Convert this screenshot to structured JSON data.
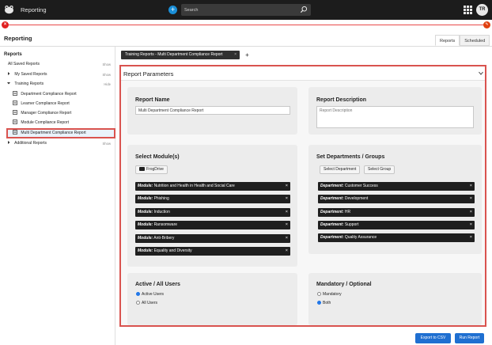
{
  "header": {
    "app_title": "Reporting",
    "search_placeholder": "Search",
    "avatar_initials": "TR"
  },
  "page": {
    "title": "Reporting",
    "tabs": [
      "Reports",
      "Scheduled"
    ]
  },
  "sidebar": {
    "heading": "Reports",
    "items": [
      {
        "label": "All Saved Reports",
        "toggle": "Show"
      },
      {
        "label": "My Saved Reports",
        "toggle": "Show"
      },
      {
        "label": "Training Reports",
        "toggle": "Hide"
      },
      {
        "label": "Department Compliance Report"
      },
      {
        "label": "Learner Compliance Report"
      },
      {
        "label": "Manager Compliance Report"
      },
      {
        "label": "Module Compliance Report"
      },
      {
        "label": "Multi Department Compliance Report"
      },
      {
        "label": "Additional Reports",
        "toggle": "Show"
      }
    ]
  },
  "report_tab": {
    "label": "Training Reports - Multi Department Compliance Report",
    "close": "×",
    "add": "+"
  },
  "params": {
    "title": "Report Parameters",
    "report_name": {
      "label": "Report Name",
      "value": "Multi Department Compliance Report"
    },
    "report_description": {
      "label": "Report Description",
      "value": "Report Description"
    },
    "modules": {
      "label": "Select Module(s)",
      "button": "FrogDrive",
      "chips": [
        {
          "prefix": "Module:",
          "name": "Nutrition and Health in Health and Social Care"
        },
        {
          "prefix": "Module:",
          "name": "Phishing"
        },
        {
          "prefix": "Module:",
          "name": "Induction"
        },
        {
          "prefix": "Module:",
          "name": "Ransomware"
        },
        {
          "prefix": "Module:",
          "name": "Anti-Bribery"
        },
        {
          "prefix": "Module:",
          "name": "Equality and Diversity"
        }
      ]
    },
    "departments": {
      "label": "Set Departments / Groups",
      "select_department": "Select Department",
      "select_group": "Select Group",
      "chips": [
        {
          "prefix": "Department:",
          "name": "Customer Success"
        },
        {
          "prefix": "Department:",
          "name": "Development"
        },
        {
          "prefix": "Department:",
          "name": "HR"
        },
        {
          "prefix": "Department:",
          "name": "Support"
        },
        {
          "prefix": "Department:",
          "name": "Quality Assurance"
        }
      ]
    },
    "users": {
      "label": "Active / All Users",
      "options": [
        "Active Users",
        "All Users"
      ],
      "selected": "Active Users"
    },
    "mandatory": {
      "label": "Mandatory / Optional",
      "options": [
        "Mandatory",
        "Both"
      ],
      "selected": "Both"
    },
    "chip_remove": "×"
  },
  "actions": {
    "export": "Export to CSV",
    "run": "Run Report"
  },
  "colors": {
    "accent_blue": "#1f6fd1",
    "highlight_red": "#d9534f",
    "topbar": "#1c1c1c",
    "chip": "#1f1f1f"
  }
}
